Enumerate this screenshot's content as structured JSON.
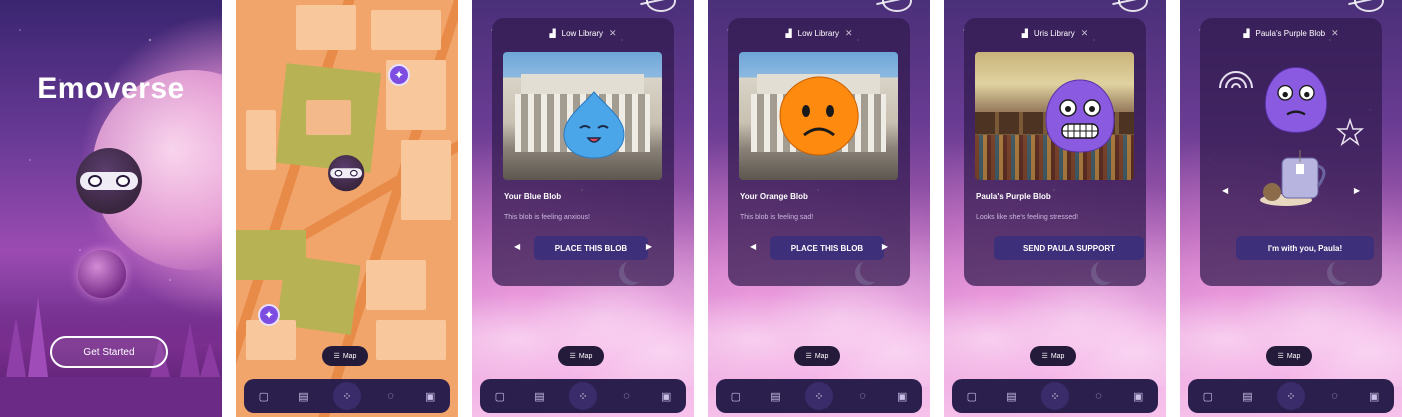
{
  "splash": {
    "title": "Emoverse",
    "cta": "Get Started"
  },
  "map_pill": "Map",
  "nav_icons": [
    "calendar-icon",
    "store-icon",
    "grid-icon",
    "chat-icon",
    "profile-icon"
  ],
  "cards": [
    {
      "tab": "Low Library",
      "title": "Your Blue Blob",
      "subtitle": "This blob is feeling anxious!",
      "button": "PLACE THIS BLOB",
      "blob_color": "#4aa6e8"
    },
    {
      "tab": "Low Library",
      "title": "Your Orange Blob",
      "subtitle": "This blob is feeling sad!",
      "button": "PLACE THIS BLOB",
      "blob_color": "#ff8a10"
    },
    {
      "tab": "Uris Library",
      "title": "Paula's Purple Blob",
      "subtitle": "Looks like she's feeling stressed!",
      "button": "SEND PAULA SUPPORT",
      "blob_color": "#8a5ae0"
    },
    {
      "tab": "Paula's Purple Blob",
      "button": "I'm with you, Paula!",
      "blob_color": "#8a5ae0"
    }
  ],
  "colors": {
    "card_bg": "#301a4e",
    "button": "#3d2f7a",
    "navbar": "#2b1f4e",
    "map_land": "#f1a56b",
    "map_green": "#b7b254",
    "pin": "#7c4de0"
  }
}
